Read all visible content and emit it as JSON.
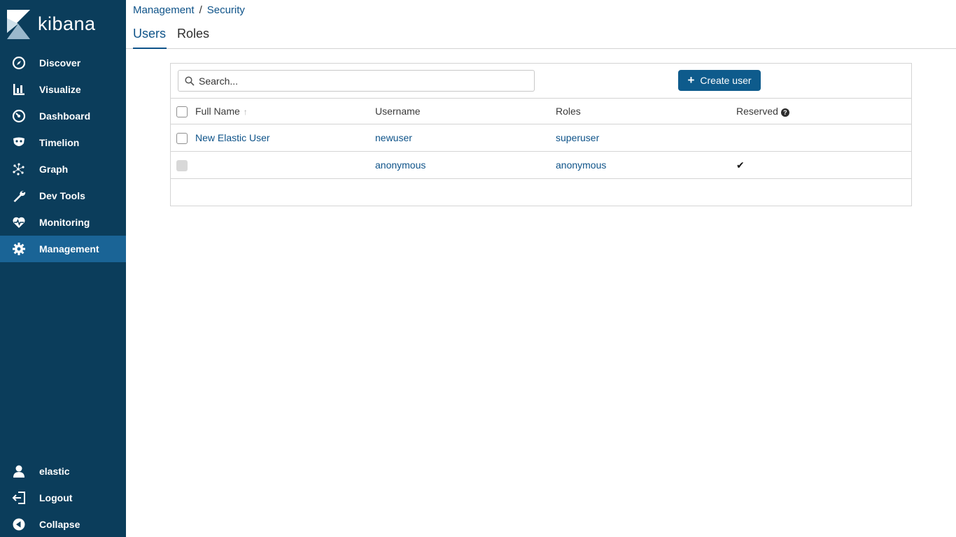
{
  "app": {
    "logo_text": "kibana"
  },
  "sidebar": {
    "items": [
      {
        "label": "Discover",
        "icon": "compass-icon"
      },
      {
        "label": "Visualize",
        "icon": "bar-chart-icon"
      },
      {
        "label": "Dashboard",
        "icon": "dashboard-gauge-icon"
      },
      {
        "label": "Timelion",
        "icon": "timelion-mask-icon"
      },
      {
        "label": "Graph",
        "icon": "graph-network-icon"
      },
      {
        "label": "Dev Tools",
        "icon": "wrench-icon"
      },
      {
        "label": "Monitoring",
        "icon": "heartbeat-icon"
      },
      {
        "label": "Management",
        "icon": "gear-icon",
        "active": true
      }
    ],
    "bottom_items": [
      {
        "label": "elastic",
        "icon": "user-icon"
      },
      {
        "label": "Logout",
        "icon": "logout-icon"
      },
      {
        "label": "Collapse",
        "icon": "collapse-left-icon"
      }
    ]
  },
  "breadcrumb": {
    "items": [
      "Management",
      "Security"
    ],
    "separator": "/"
  },
  "tabs": [
    {
      "label": "Users",
      "active": true
    },
    {
      "label": "Roles",
      "active": false
    }
  ],
  "search": {
    "placeholder": "Search..."
  },
  "create_button": {
    "label": "Create user"
  },
  "table": {
    "columns": [
      "Full Name",
      "Username",
      "Roles",
      "Reserved"
    ],
    "sort_indicator": "↑",
    "rows": [
      {
        "full_name": "New Elastic User",
        "username": "newuser",
        "roles": "superuser",
        "reserved": false,
        "selectable": true
      },
      {
        "full_name": "",
        "username": "anonymous",
        "roles": "anonymous",
        "reserved": true,
        "selectable": false
      }
    ],
    "reserved_mark": "✔"
  },
  "colors": {
    "sidebar_bg": "#0b3d5b",
    "active_nav": "#1a6496",
    "link": "#0e5389",
    "primary_button": "#0e5b8c"
  }
}
